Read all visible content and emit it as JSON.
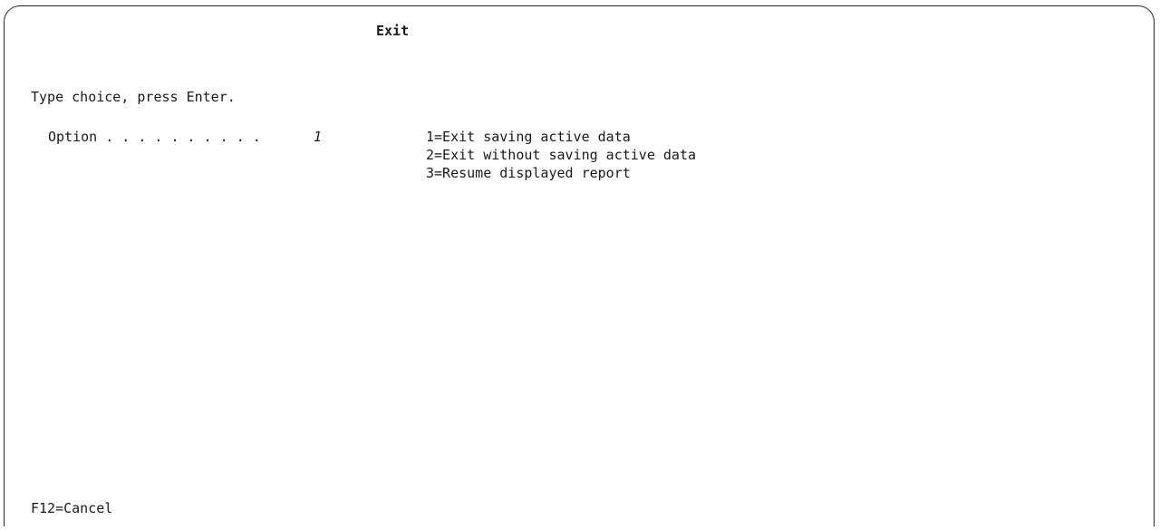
{
  "screen": {
    "title": "Exit",
    "instruction": "Type choice, press Enter.",
    "option": {
      "label": "Option . . . . . . . . . .",
      "value": "1"
    },
    "choices": [
      "1=Exit saving active data",
      "2=Exit without saving active data",
      "3=Resume displayed report"
    ],
    "function_keys": [
      "F12=Cancel"
    ]
  }
}
